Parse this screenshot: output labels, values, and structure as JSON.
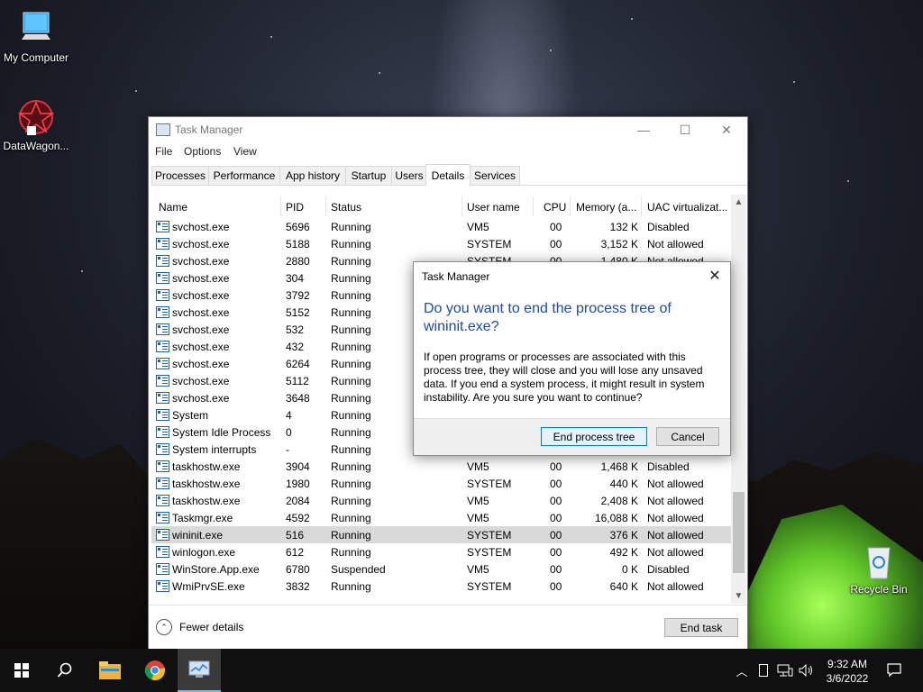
{
  "desktop": {
    "icons": [
      {
        "label": "My Computer",
        "icon": "computer-icon"
      },
      {
        "label": "DataWagon...",
        "icon": "datawagon-icon"
      },
      {
        "label": "Recycle Bin",
        "icon": "recycle-bin-icon"
      }
    ]
  },
  "task_manager": {
    "title": "Task Manager",
    "menu": [
      "File",
      "Options",
      "View"
    ],
    "tabs": [
      "Processes",
      "Performance",
      "App history",
      "Startup",
      "Users",
      "Details",
      "Services"
    ],
    "active_tab": "Details",
    "columns": [
      "Name",
      "PID",
      "Status",
      "User name",
      "CPU",
      "Memory (a...",
      "UAC virtualizat..."
    ],
    "rows": [
      {
        "name": "svchost.exe",
        "pid": "5696",
        "status": "Running",
        "user": "VM5",
        "cpu": "00",
        "mem": "132 K",
        "uac": "Disabled"
      },
      {
        "name": "svchost.exe",
        "pid": "5188",
        "status": "Running",
        "user": "SYSTEM",
        "cpu": "00",
        "mem": "3,152 K",
        "uac": "Not allowed"
      },
      {
        "name": "svchost.exe",
        "pid": "2880",
        "status": "Running",
        "user": "SYSTEM",
        "cpu": "00",
        "mem": "1,480 K",
        "uac": "Not allowed"
      },
      {
        "name": "svchost.exe",
        "pid": "304",
        "status": "Running",
        "user": "",
        "cpu": "",
        "mem": "",
        "uac": ""
      },
      {
        "name": "svchost.exe",
        "pid": "3792",
        "status": "Running",
        "user": "",
        "cpu": "",
        "mem": "",
        "uac": ""
      },
      {
        "name": "svchost.exe",
        "pid": "5152",
        "status": "Running",
        "user": "",
        "cpu": "",
        "mem": "",
        "uac": ""
      },
      {
        "name": "svchost.exe",
        "pid": "532",
        "status": "Running",
        "user": "",
        "cpu": "",
        "mem": "",
        "uac": ""
      },
      {
        "name": "svchost.exe",
        "pid": "432",
        "status": "Running",
        "user": "",
        "cpu": "",
        "mem": "",
        "uac": ""
      },
      {
        "name": "svchost.exe",
        "pid": "6264",
        "status": "Running",
        "user": "",
        "cpu": "",
        "mem": "",
        "uac": ""
      },
      {
        "name": "svchost.exe",
        "pid": "5112",
        "status": "Running",
        "user": "",
        "cpu": "",
        "mem": "",
        "uac": ""
      },
      {
        "name": "svchost.exe",
        "pid": "3648",
        "status": "Running",
        "user": "",
        "cpu": "",
        "mem": "",
        "uac": ""
      },
      {
        "name": "System",
        "pid": "4",
        "status": "Running",
        "user": "",
        "cpu": "",
        "mem": "",
        "uac": ""
      },
      {
        "name": "System Idle Process",
        "pid": "0",
        "status": "Running",
        "user": "",
        "cpu": "",
        "mem": "",
        "uac": ""
      },
      {
        "name": "System interrupts",
        "pid": "-",
        "status": "Running",
        "user": "",
        "cpu": "",
        "mem": "",
        "uac": ""
      },
      {
        "name": "taskhostw.exe",
        "pid": "3904",
        "status": "Running",
        "user": "VM5",
        "cpu": "00",
        "mem": "1,468 K",
        "uac": "Disabled"
      },
      {
        "name": "taskhostw.exe",
        "pid": "1980",
        "status": "Running",
        "user": "SYSTEM",
        "cpu": "00",
        "mem": "440 K",
        "uac": "Not allowed"
      },
      {
        "name": "taskhostw.exe",
        "pid": "2084",
        "status": "Running",
        "user": "VM5",
        "cpu": "00",
        "mem": "2,408 K",
        "uac": "Not allowed"
      },
      {
        "name": "Taskmgr.exe",
        "pid": "4592",
        "status": "Running",
        "user": "VM5",
        "cpu": "00",
        "mem": "16,088 K",
        "uac": "Not allowed"
      },
      {
        "name": "wininit.exe",
        "pid": "516",
        "status": "Running",
        "user": "SYSTEM",
        "cpu": "00",
        "mem": "376 K",
        "uac": "Not allowed",
        "selected": true
      },
      {
        "name": "winlogon.exe",
        "pid": "612",
        "status": "Running",
        "user": "SYSTEM",
        "cpu": "00",
        "mem": "492 K",
        "uac": "Not allowed"
      },
      {
        "name": "WinStore.App.exe",
        "pid": "6780",
        "status": "Suspended",
        "user": "VM5",
        "cpu": "00",
        "mem": "0 K",
        "uac": "Disabled"
      },
      {
        "name": "WmiPrvSE.exe",
        "pid": "3832",
        "status": "Running",
        "user": "SYSTEM",
        "cpu": "00",
        "mem": "640 K",
        "uac": "Not allowed"
      }
    ],
    "fewer_details": "Fewer details",
    "end_task": "End task"
  },
  "dialog": {
    "title": "Task Manager",
    "heading": "Do you want to end the process tree of wininit.exe?",
    "body": "If open programs or processes are associated with this process tree, they will close and you will lose any unsaved data. If you end a system process, it might result in system instability. Are you sure you want to continue?",
    "confirm": "End process tree",
    "cancel": "Cancel"
  },
  "taskbar": {
    "items": [
      "start-icon",
      "search-icon",
      "file-explorer-icon",
      "chrome-icon",
      "task-manager-icon"
    ],
    "time": "9:32 AM",
    "date": "3/6/2022"
  }
}
